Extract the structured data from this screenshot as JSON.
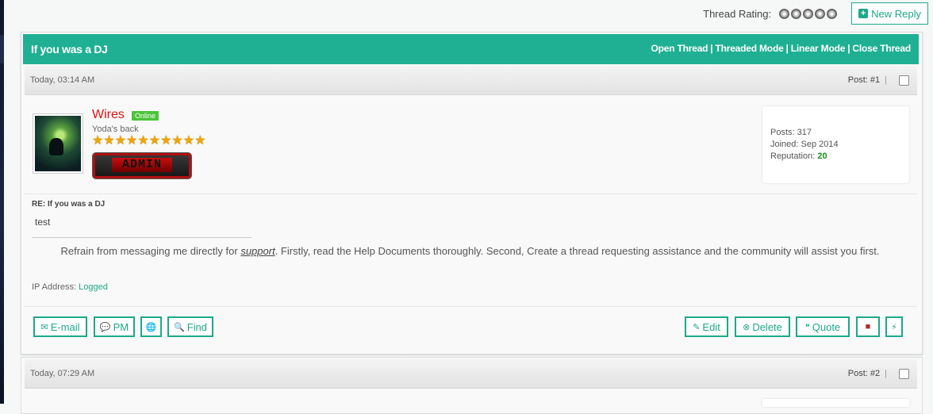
{
  "toolbar": {
    "rating_label": "Thread Rating:",
    "new_reply": "New Reply"
  },
  "thread": {
    "title": "If you was a DJ",
    "links": [
      "Open Thread",
      "Threaded Mode",
      "Linear Mode",
      "Close Thread"
    ]
  },
  "posts": [
    {
      "date": "Today, 03:14 AM",
      "number": "Post: #1",
      "author": {
        "name": "Wires",
        "status": "Online",
        "title": "Yoda's back",
        "badge": "ADMIN",
        "stars": "★★★★★★★★★★",
        "posts_label": "Posts:",
        "posts": "317",
        "joined_label": "Joined:",
        "joined": "Sep 2014",
        "reputation_label": "Reputation:",
        "reputation": "20"
      },
      "subject": "RE: If you was a DJ",
      "body": "test",
      "signature_pre": "Refrain from messaging me directly for ",
      "signature_link": "support",
      "signature_post": ". Firstly, read the Help Documents thoroughly. Second, Create a thread requesting assistance and the community will assist you first.",
      "ip_label": "IP Address:",
      "ip_value": "Logged",
      "buttons_left": {
        "email": "E-mail",
        "pm": "PM",
        "find": "Find"
      },
      "buttons_right": {
        "edit": "Edit",
        "delete": "Delete",
        "quote": "Quote"
      }
    },
    {
      "date": "Today, 07:29 AM",
      "number": "Post: #2"
    }
  ],
  "colors": {
    "accent": "#1fb093",
    "username": "#e01010",
    "online": "#4cc33a",
    "reputation": "#1a8f1a"
  }
}
